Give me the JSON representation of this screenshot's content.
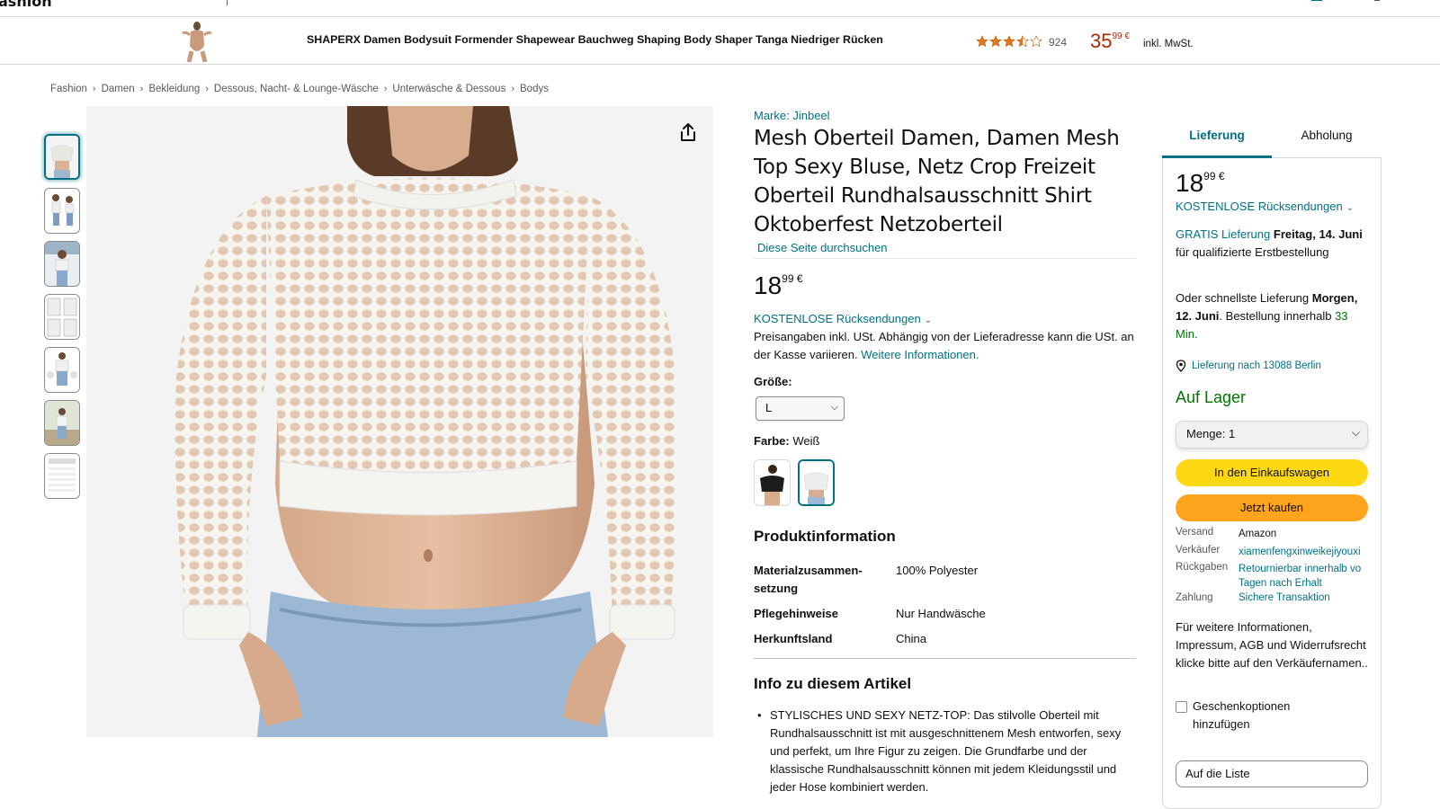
{
  "topbar": {
    "brand": "ashion"
  },
  "sticky": {
    "title": "SHAPERX Damen Bodysuit Formender Shapewear Bauchweg Shaping Body Shaper Tanga Niedriger Rücken",
    "rating": 3.5,
    "rating_count": "924",
    "price_whole": "35",
    "price_fraction": "99 €",
    "vat": "inkl. MwSt."
  },
  "breadcrumb": [
    "Fashion",
    "Damen",
    "Bekleidung",
    "Dessous, Nacht- & Lounge-Wäsche",
    "Unterwäsche & Dessous",
    "Bodys"
  ],
  "product": {
    "brand": "Marke: Jinbeel",
    "title": "Mesh Oberteil Damen, Damen Mesh Top Sexy Bluse, Netz Crop Freizeit Oberteil Rundhalsausschnitt Shirt Oktoberfest Netzoberteil",
    "search_store": "Diese Seite durchsuchen",
    "price_whole": "18",
    "price_fraction": "99 €",
    "returns": "KOSTENLOSE Rücksendungen",
    "tax_note": "Preisangaben inkl. USt. Abhängig von der Lieferadresse kann die USt. an der Kasse variieren. ",
    "tax_link": "Weitere Informationen.",
    "size_label": "Größe:",
    "size_value": "L",
    "color_label": "Farbe:",
    "color_value": "Weiß",
    "info_title": "Produktinformation",
    "info_rows": [
      {
        "key": "Materialzusammen-setzung",
        "value": "100% Polyester"
      },
      {
        "key": "Pflegehinweise",
        "value": "Nur Handwäsche"
      },
      {
        "key": "Herkunftsland",
        "value": "China"
      }
    ],
    "about_title": "Info zu diesem Artikel",
    "bullets": [
      "STYLISCHES UND SEXY NETZ-TOP: Das stilvolle Oberteil mit Rundhalsausschnitt ist mit ausgeschnittenem Mesh entworfen, sexy und perfekt, um Ihre Figur zu zeigen. Die Grundfarbe und der klassische Rundhalsausschnitt können mit jedem Kleidungsstil und jeder Hose kombiniert werden."
    ]
  },
  "buybox": {
    "tab_delivery": "Lieferung",
    "tab_pickup": "Abholung",
    "price_whole": "18",
    "price_fraction": "99 €",
    "returns": "KOSTENLOSE Rücksendungen",
    "free_delivery_link": "GRATIS Lieferung",
    "free_delivery_date": "Freitag, 14. Juni",
    "free_delivery_rest": " für qualifizierte Erstbestellung",
    "fastest_intro": "Oder schnellste Lieferung ",
    "fastest_date": "Morgen, 12. Juni",
    "fastest_rest": ". Bestellung innerhalb ",
    "fastest_time": "33 Min.",
    "location": "Lieferung nach 13088 Berlin",
    "in_stock": "Auf Lager",
    "quantity": "Menge: 1",
    "add_to_cart": "In den Einkaufswagen",
    "buy_now": "Jetzt kaufen",
    "ship_label": "Versand",
    "ship_value": "Amazon",
    "seller_label": "Verkäufer",
    "seller_value": "xiamenfengxinweikejiyouxi",
    "returns_label": "Rückgaben",
    "returns_value_1": "Retournierbar innerhalb vo",
    "returns_value_2": "Tagen nach Erhalt",
    "payment_label": "Zahlung",
    "payment_value": "Sichere Transaktion",
    "seller_note": "Für weitere Informationen, Impressum, AGB und Widerrufsrecht klicke bitte auf den Verkäufernamen..",
    "gift_option": "Geschenkoptionen hinzufügen",
    "add_to_list": "Auf die Liste"
  },
  "colors": {
    "link": "#007185",
    "price_red": "#b12704",
    "green": "#007600",
    "cart_yellow": "#ffd814",
    "buy_orange": "#ffa41c"
  },
  "icons": [
    "share-icon",
    "star-icon",
    "location-pin-icon",
    "chevron-down-icon"
  ]
}
